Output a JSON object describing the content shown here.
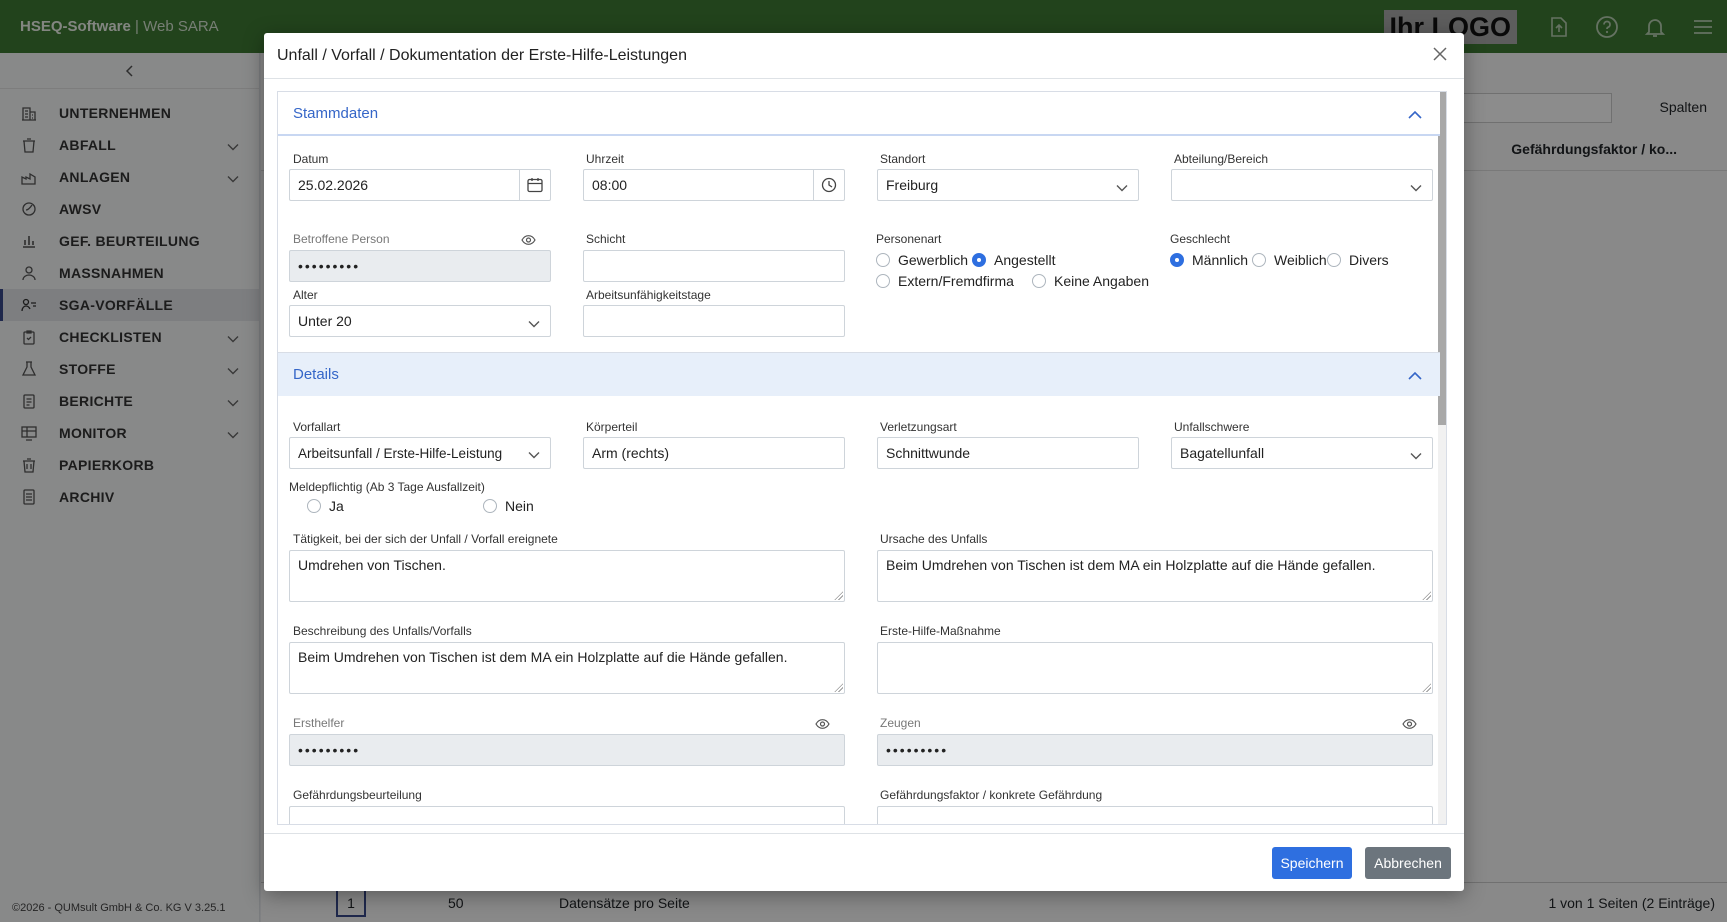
{
  "topbar": {
    "brand_bold": "HSEQ-Software",
    "brand_rest": " | Web SARA",
    "logo": "Ihr LOGO"
  },
  "sidebar": {
    "items": [
      {
        "label": "UNTERNEHMEN",
        "icon": "building-icon",
        "chev": false
      },
      {
        "label": "ABFALL",
        "icon": "trash-bin-icon",
        "chev": true
      },
      {
        "label": "ANLAGEN",
        "icon": "plant-icon",
        "chev": true
      },
      {
        "label": "AWSV",
        "icon": "leaf-icon",
        "chev": false
      },
      {
        "label": "GEF. BEURTEILUNG",
        "icon": "chart-icon",
        "chev": false
      },
      {
        "label": "MASSNAHMEN",
        "icon": "people-icon",
        "chev": false
      },
      {
        "label": "SGA-VORFÄLLE",
        "icon": "incident-icon",
        "chev": false
      },
      {
        "label": "CHECKLISTEN",
        "icon": "clipboard-icon",
        "chev": true
      },
      {
        "label": "STOFFE",
        "icon": "flask-icon",
        "chev": true
      },
      {
        "label": "BERICHTE",
        "icon": "report-icon",
        "chev": true
      },
      {
        "label": "MONITOR",
        "icon": "monitor-icon",
        "chev": true
      },
      {
        "label": "PAPIERKORB",
        "icon": "trash-icon",
        "chev": false
      },
      {
        "label": "ARCHIV",
        "icon": "archive-icon",
        "chev": false
      }
    ],
    "footer": "©2026 - QUMsult GmbH & Co. KG    V 3.25.1"
  },
  "background": {
    "spalten": "Spalten",
    "column_header": "Gefährdungsfaktor / ko...",
    "page_info": "1 von 1 Seiten (2 Einträge)",
    "per_page_value": "50",
    "per_page_label": "Datensätze pro Seite",
    "current_page": "1"
  },
  "modal": {
    "title": "Unfall / Vorfall / Dokumentation der Erste-Hilfe-Leistungen",
    "save": "Speichern",
    "cancel": "Abbrechen",
    "stammdaten": {
      "title": "Stammdaten",
      "datum_label": "Datum",
      "datum_value": "25.02.2026",
      "uhrzeit_label": "Uhrzeit",
      "uhrzeit_value": "08:00",
      "standort_label": "Standort",
      "standort_value": "Freiburg",
      "abteilung_label": "Abteilung/Bereich",
      "abteilung_value": "",
      "person_label": "Betroffene Person",
      "person_value": "•••••••••",
      "schicht_label": "Schicht",
      "schicht_value": "",
      "personenart_label": "Personenart",
      "personenart_options": [
        "Gewerblich",
        "Angestellt",
        "Extern/Fremdfirma",
        "Keine Angaben"
      ],
      "personenart_selected": "Angestellt",
      "geschlecht_label": "Geschlecht",
      "geschlecht_options": [
        "Männlich",
        "Weiblich",
        "Divers"
      ],
      "geschlecht_selected": "Männlich",
      "alter_label": "Alter",
      "alter_value": "Unter 20",
      "au_label": "Arbeitsunfähigkeitstage",
      "au_value": ""
    },
    "details": {
      "title": "Details",
      "vorfallart_label": "Vorfallart",
      "vorfallart_value": "Arbeitsunfall / Erste-Hilfe-Leistung",
      "koerperteil_label": "Körperteil",
      "koerperteil_value": "Arm (rechts)",
      "verletzungsart_label": "Verletzungsart",
      "verletzungsart_value": "Schnittwunde",
      "unfallschwere_label": "Unfallschwere",
      "unfallschwere_value": "Bagatellunfall",
      "melde_label": "Meldepflichtig (Ab 3 Tage Ausfallzeit)",
      "melde_ja": "Ja",
      "melde_nein": "Nein",
      "taetigkeit_label": "Tätigkeit, bei der sich der Unfall / Vorfall ereignete",
      "taetigkeit_value": "Umdrehen von Tischen.",
      "ursache_label": "Ursache des Unfalls",
      "ursache_value": "Beim Umdrehen von Tischen ist dem MA ein Holzplatte auf die Hände gefallen.",
      "beschreibung_label": "Beschreibung des Unfalls/Vorfalls",
      "beschreibung_value": "Beim Umdrehen von Tischen ist dem MA ein Holzplatte auf die Hände gefallen.",
      "erstehilfe_label": "Erste-Hilfe-Maßnahme",
      "erstehilfe_value": "",
      "ersthelfer_label": "Ersthelfer",
      "ersthelfer_value": "•••••••••",
      "zeugen_label": "Zeugen",
      "zeugen_value": "•••••••••",
      "gefbeurteilung_label": "Gefährdungsbeurteilung",
      "gefaktor_label": "Gefährdungsfaktor / konkrete Gefährdung"
    }
  }
}
